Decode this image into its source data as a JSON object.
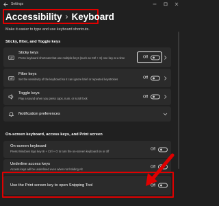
{
  "window": {
    "app_title": "Settings",
    "back_icon": "arrow-left-icon",
    "controls": [
      "minimize-icon",
      "maximize-icon",
      "close-icon"
    ]
  },
  "breadcrumb": {
    "parent": "Accessibility",
    "separator": "›",
    "current": "Keyboard"
  },
  "intro": "Make it easier to type and use keyboard shortcuts.",
  "sections": {
    "sticky": {
      "heading": "Sticky, filter, and Toggle keys"
    },
    "onscreen": {
      "heading": "On-screen keyboard, access keys, and Print screen"
    }
  },
  "settings": {
    "sticky_keys": {
      "title": "Sticky keys",
      "desc": "Press keyboard shortcuts that use multiple keys (such as Ctrl + S) one key at a time",
      "state": "Off",
      "on": false,
      "icon": "sticky-keys-icon"
    },
    "filter_keys": {
      "title": "Filter keys",
      "desc": "Set the sensitivity of the keyboard so it can ignore brief or repeated keystrokes",
      "state": "Off",
      "on": false,
      "icon": "filter-keys-icon"
    },
    "toggle_keys": {
      "title": "Toggle keys",
      "desc": "Play a sound when you press caps, num, or scroll lock",
      "state": "Off",
      "on": false,
      "icon": "speaker-icon"
    },
    "notification_preferences": {
      "title": "Notification preferences",
      "icon": "bell-icon"
    },
    "onscreen_keyboard": {
      "title": "On-screen keyboard",
      "desc": "Press Windows logo key ⊞ + Ctrl + O to turn the on-screen keyboard on or off",
      "state": "Off",
      "on": false
    },
    "underline_access_keys": {
      "title": "Underline access keys",
      "desc": "Access keys will be underlined even when not holding Alt",
      "state": "Off",
      "on": false
    },
    "print_screen": {
      "title": "Use the Print screen key to open Snipping Tool",
      "state": "Off",
      "on": false
    }
  },
  "colors": {
    "background": "#202020",
    "card": "#2b2b2b",
    "annotation": "#e00000"
  }
}
